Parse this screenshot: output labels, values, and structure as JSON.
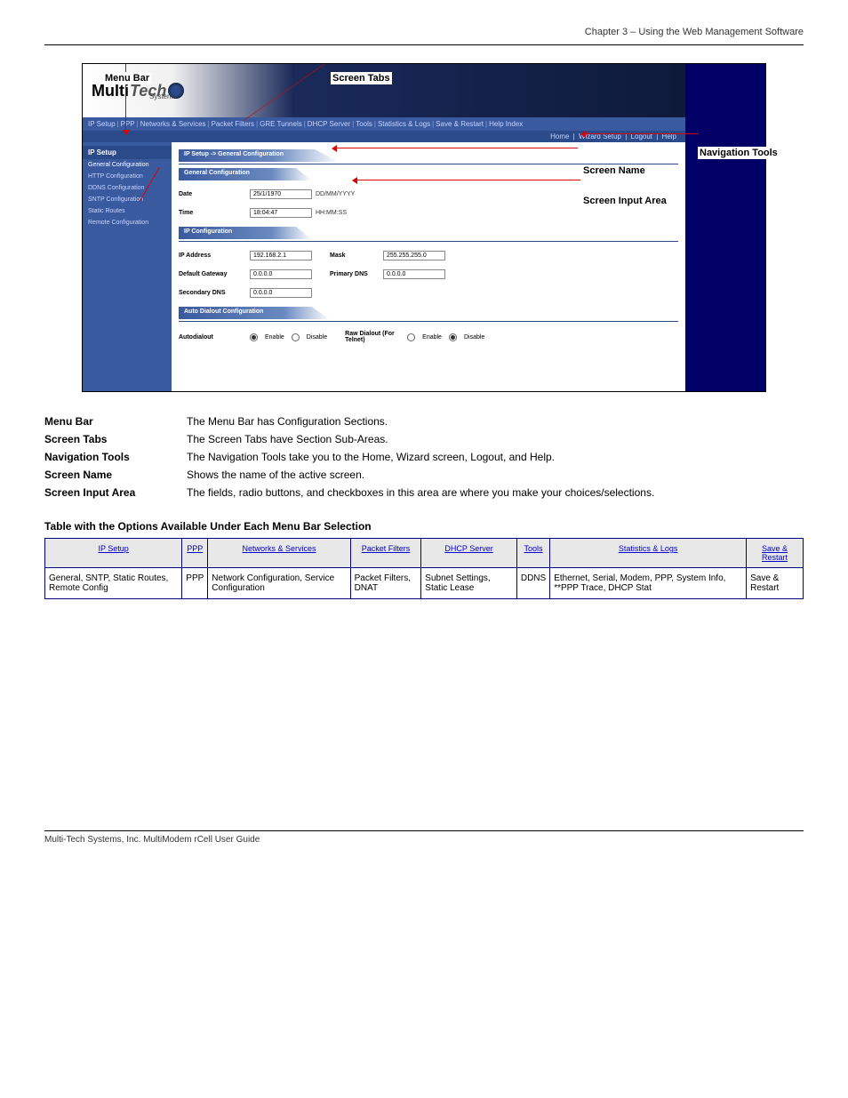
{
  "header_text": "Chapter 3 – Using the Web Management Software",
  "screenshot": {
    "logo_multi": "Multi",
    "logo_tech": "Tech",
    "logo_systems": "Systems",
    "nav": [
      "IP Setup",
      "PPP",
      "Networks & Services",
      "Packet Filters",
      "GRE Tunnels",
      "DHCP Server",
      "Tools",
      "Statistics & Logs",
      "Save & Restart",
      "Help Index"
    ],
    "subnav": [
      "Home",
      "Wizard Setup",
      "Logout",
      "Help"
    ],
    "sidebar_header": "IP Setup",
    "sidebar_items": [
      "General Configuration",
      "HTTP Configuration",
      "DDNS Configuration",
      "SNTP Configuration",
      "Static Routes",
      "Remote Configuration"
    ],
    "breadcrumb": "IP Setup -> General Configuration",
    "section_general": "General Configuration",
    "date_label": "Date",
    "date_value": "25/1/1970",
    "date_hint": "DD/MM/YYYY",
    "time_label": "Time",
    "time_value": "18:04:47",
    "time_hint": "HH:MM:SS",
    "section_ip": "IP Configuration",
    "ip_label": "IP Address",
    "ip_value": "192.168.2.1",
    "mask_label": "Mask",
    "mask_value": "255.255.255.0",
    "gw_label": "Default Gateway",
    "gw_value": "0.0.0.0",
    "pdns_label": "Primary DNS",
    "pdns_value": "0.0.0.0",
    "sdns_label": "Secondary DNS",
    "sdns_value": "0.0.0.0",
    "section_auto": "Auto Dialout Configuration",
    "auto_label": "Autodialout",
    "enable": "Enable",
    "disable": "Disable",
    "raw_label": "Raw Dialout (For Telnet)",
    "overlay_menubar": "Menu Bar",
    "overlay_screentabs": "Screen Tabs",
    "overlay_navtools": "Navigation Tools",
    "overlay_screenname": "Screen Name",
    "overlay_inputarea": "Screen Input Area"
  },
  "captions": [
    {
      "label": "Menu Bar",
      "text": "The Menu Bar has Configuration Sections."
    },
    {
      "label": "Screen Tabs",
      "text": "The Screen Tabs have Section Sub-Areas."
    },
    {
      "label": "Navigation Tools",
      "text": "The Navigation Tools take you to the Home, Wizard screen, Logout, and Help."
    },
    {
      "label": "Screen Name",
      "text": "Shows the name of the active screen."
    },
    {
      "label": "Screen Input Area",
      "text": "The fields, radio buttons, and checkboxes in this area are where you make your choices/selections."
    }
  ],
  "table_title": "Table with the Options Available Under Each Menu Bar Selection",
  "table_headers": [
    "IP Setup",
    "PPP",
    "Networks & Services",
    "Packet Filters",
    "DHCP Server",
    "Tools",
    "Statistics & Logs",
    "Save & Restart"
  ],
  "table_cells": [
    "General, SNTP, Static Routes, Remote Config",
    "PPP",
    "Network Configuration, Service Configuration",
    "Packet Filters, DNAT",
    "Subnet Settings, Static Lease",
    "DDNS",
    "Ethernet, Serial, Modem, PPP, System Info, **PPP Trace, DHCP Stat",
    "Save & Restart"
  ],
  "footer": "Multi-Tech Systems, Inc. MultiModem rCell User Guide"
}
